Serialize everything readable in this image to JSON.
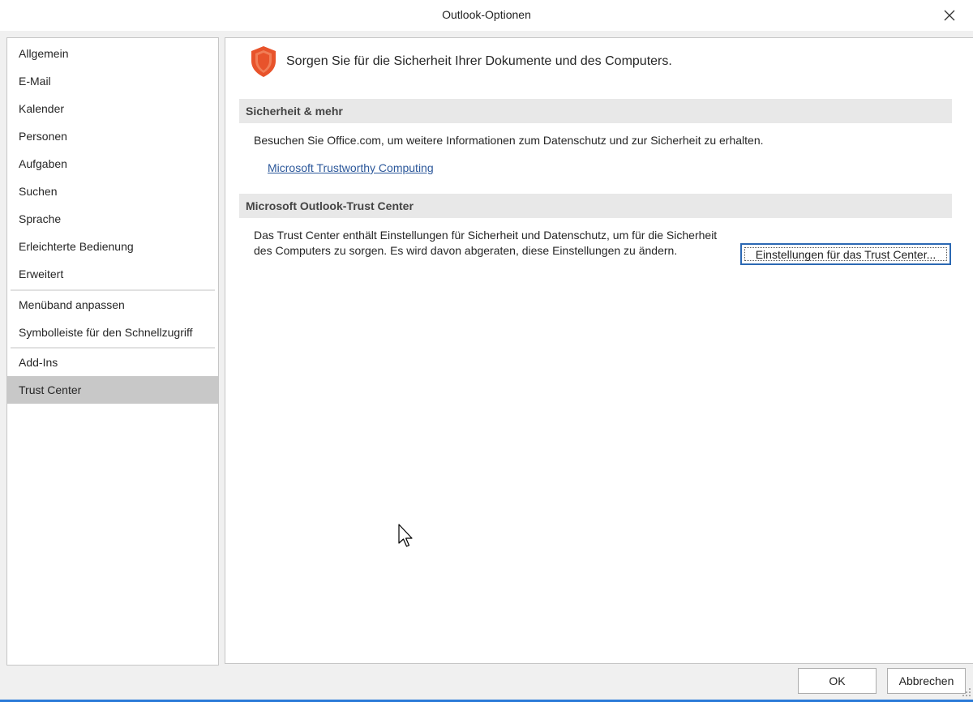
{
  "window": {
    "title": "Outlook-Optionen"
  },
  "sidebar": {
    "items": [
      {
        "label": "Allgemein"
      },
      {
        "label": "E-Mail"
      },
      {
        "label": "Kalender"
      },
      {
        "label": "Personen"
      },
      {
        "label": "Aufgaben"
      },
      {
        "label": "Suchen"
      },
      {
        "label": "Sprache"
      },
      {
        "label": "Erleichterte Bedienung"
      },
      {
        "label": "Erweitert"
      },
      {
        "label": "Menüband anpassen"
      },
      {
        "label": "Symbolleiste für den Schnellzugriff"
      },
      {
        "label": "Add-Ins"
      },
      {
        "label": "Trust Center",
        "selected": true
      }
    ]
  },
  "main": {
    "header": "Sorgen Sie für die Sicherheit Ihrer Dokumente und des Computers.",
    "section1": {
      "title": "Sicherheit & mehr",
      "text": "Besuchen Sie Office.com, um weitere Informationen zum Datenschutz und zur Sicherheit zu erhalten.",
      "link": "Microsoft Trustworthy Computing"
    },
    "section2": {
      "title": "Microsoft Outlook-Trust Center",
      "text": "Das Trust Center enthält Einstellungen für Sicherheit und Datenschutz, um für die Sicherheit des Computers zu sorgen. Es wird davon abgeraten, diese Einstellungen zu ändern.",
      "button": "Einstellungen für das Trust Center..."
    }
  },
  "footer": {
    "ok": "OK",
    "cancel": "Abbrechen"
  },
  "icons": {
    "close": "close-icon",
    "shield": "shield-icon",
    "cursor": "mouse-cursor-icon",
    "grip": "resize-grip-icon"
  },
  "colors": {
    "accent": "#2b579a",
    "shield": "#e8532b",
    "selected_nav": "#c8c8c8",
    "section_header": "#e8e8e8",
    "focus_border": "#2b68b3"
  }
}
